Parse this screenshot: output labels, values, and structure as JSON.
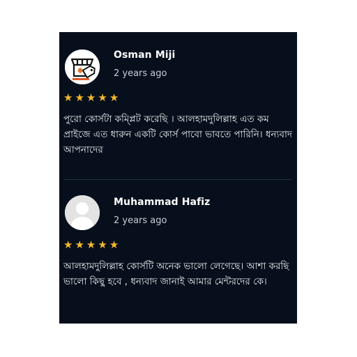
{
  "reviews": [
    {
      "name": "Osman Miji",
      "time": "2 years ago",
      "rating": 5,
      "text": "পুরো কোর্সটা কম্প্লিট করেছি । আলহামদুলিল্লাহ এত কম প্রাইজে এত ধারুন একটি কোর্স পাবো ভাবতে পারিনি। ধন্যবাদ আপনাদের",
      "avatar": "shop-logo-icon"
    },
    {
      "name": "Muhammad Hafiz",
      "time": "2 years ago",
      "rating": 5,
      "text": "আলহামদুলিল্লাহ কোর্সটি অনেক ভালো লেগেছে। আশা করছি ভালো কিছু হবে , ধন্যবাদ জানাই আমার মেন্টরদের কে।",
      "avatar": "default-user-avatar-icon"
    }
  ],
  "colors": {
    "panel_bg": "#060f1b",
    "star": "#f5b82e"
  }
}
